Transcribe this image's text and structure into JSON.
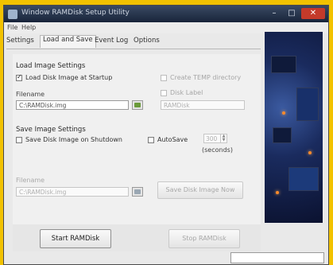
{
  "window": {
    "title": "Window RAMDisk Setup Utility"
  },
  "menubar": {
    "file": "File",
    "help": "Help"
  },
  "tabs": [
    {
      "label": "Settings"
    },
    {
      "label": "Load and Save"
    },
    {
      "label": "Event Log"
    },
    {
      "label": "Options"
    }
  ],
  "load": {
    "heading": "Load Image Settings",
    "load_at_startup": {
      "label": "Load Disk Image at Startup",
      "checked": true
    },
    "create_temp": {
      "label": "Create TEMP directory",
      "checked": false
    },
    "filename_label": "Filename",
    "filename_value": "C:\\RAMDisk.img",
    "disk_label_toggle": {
      "label": "Disk Label",
      "checked": false
    },
    "disk_label_value": "RAMDisk"
  },
  "save": {
    "heading": "Save Image Settings",
    "save_on_shutdown": {
      "label": "Save Disk Image on Shutdown",
      "checked": false
    },
    "autosave": {
      "label": "AutoSave",
      "checked": false
    },
    "interval_value": "300",
    "seconds_label": "(seconds)",
    "filename_label": "Filename",
    "filename_value": "C:\\RAMDisk.img",
    "save_now_label": "Save Disk Image Now"
  },
  "actions": {
    "start_label": "Start RAMDisk",
    "stop_label": "Stop RAMDisk"
  },
  "colors": {
    "accent_frame": "#f2c200",
    "close_button": "#c43a2a"
  }
}
